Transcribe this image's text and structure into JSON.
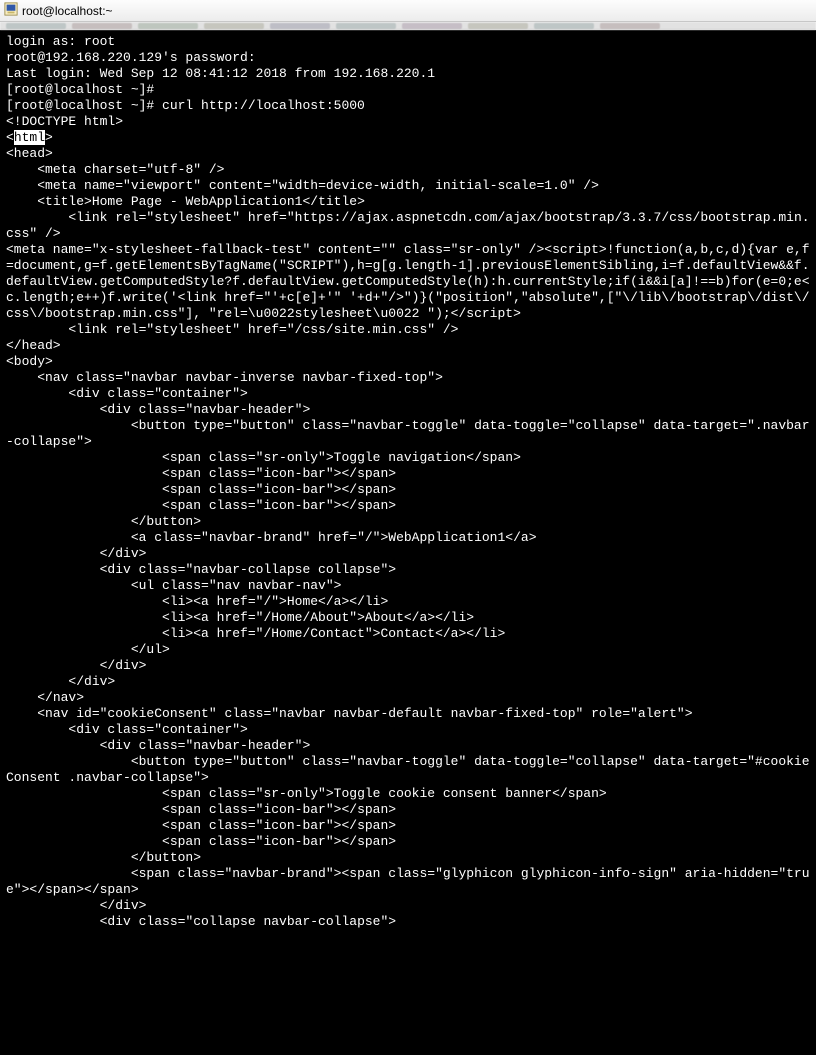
{
  "window": {
    "title": "root@localhost:~"
  },
  "terminal": {
    "lines": [
      "login as: root",
      "root@192.168.220.129's password:",
      "Last login: Wed Sep 12 08:41:12 2018 from 192.168.220.1",
      "[root@localhost ~]#",
      "[root@localhost ~]# curl http://localhost:5000",
      "<!DOCTYPE html>",
      "<html>",
      "<head>",
      "    <meta charset=\"utf-8\" />",
      "    <meta name=\"viewport\" content=\"width=device-width, initial-scale=1.0\" />",
      "    <title>Home Page - WebApplication1</title>",
      "",
      "",
      "",
      "        <link rel=\"stylesheet\" href=\"https://ajax.aspnetcdn.com/ajax/bootstrap/3.3.7/css/bootstrap.min.css\" />",
      "<meta name=\"x-stylesheet-fallback-test\" content=\"\" class=\"sr-only\" /><script>!function(a,b,c,d){var e,f=document,g=f.getElementsByTagName(\"SCRIPT\"),h=g[g.length-1].previousElementSibling,i=f.defaultView&&f.defaultView.getComputedStyle?f.defaultView.getComputedStyle(h):h.currentStyle;if(i&&i[a]!==b)for(e=0;e<c.length;e++)f.write('<link href=\"'+c[e]+'\" '+d+\"/>\")}(\"position\",\"absolute\",[\"\\/lib\\/bootstrap\\/dist\\/css\\/bootstrap.min.css\"], \"rel=\\u0022stylesheet\\u0022 \");</script>",
      "        <link rel=\"stylesheet\" href=\"/css/site.min.css\" />",
      "",
      "</head>",
      "<body>",
      "    <nav class=\"navbar navbar-inverse navbar-fixed-top\">",
      "        <div class=\"container\">",
      "            <div class=\"navbar-header\">",
      "                <button type=\"button\" class=\"navbar-toggle\" data-toggle=\"collapse\" data-target=\".navbar-collapse\">",
      "                    <span class=\"sr-only\">Toggle navigation</span>",
      "                    <span class=\"icon-bar\"></span>",
      "                    <span class=\"icon-bar\"></span>",
      "                    <span class=\"icon-bar\"></span>",
      "                </button>",
      "                <a class=\"navbar-brand\" href=\"/\">WebApplication1</a>",
      "            </div>",
      "            <div class=\"navbar-collapse collapse\">",
      "                <ul class=\"nav navbar-nav\">",
      "                    <li><a href=\"/\">Home</a></li>",
      "                    <li><a href=\"/Home/About\">About</a></li>",
      "                    <li><a href=\"/Home/Contact\">Contact</a></li>",
      "                </ul>",
      "            </div>",
      "        </div>",
      "    </nav>",
      "",
      "",
      "",
      "    <nav id=\"cookieConsent\" class=\"navbar navbar-default navbar-fixed-top\" role=\"alert\">",
      "        <div class=\"container\">",
      "            <div class=\"navbar-header\">",
      "                <button type=\"button\" class=\"navbar-toggle\" data-toggle=\"collapse\" data-target=\"#cookieConsent .navbar-collapse\">",
      "                    <span class=\"sr-only\">Toggle cookie consent banner</span>",
      "                    <span class=\"icon-bar\"></span>",
      "                    <span class=\"icon-bar\"></span>",
      "                    <span class=\"icon-bar\"></span>",
      "                </button>",
      "                <span class=\"navbar-brand\"><span class=\"glyphicon glyphicon-info-sign\" aria-hidden=\"true\"></span></span>",
      "            </div>",
      "            <div class=\"collapse navbar-collapse\">"
    ],
    "highlight_line_index": 6,
    "highlight_text": "html"
  }
}
